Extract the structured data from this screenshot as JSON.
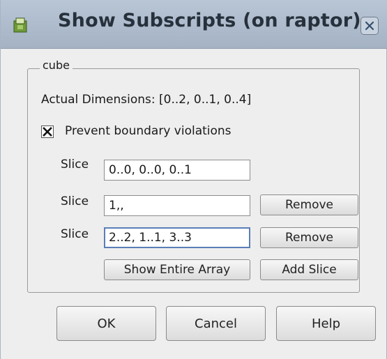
{
  "window": {
    "title": "Show Subscripts (on raptor)"
  },
  "icons": {
    "app": "app-icon",
    "close": "close-icon",
    "checkbox": "check-x-icon"
  },
  "group": {
    "legend": "cube",
    "dimensions_text": "Actual Dimensions: [0..2, 0..1, 0..4]",
    "checkbox": {
      "label": "Prevent boundary violations",
      "checked": true
    },
    "slices": [
      {
        "label": "Slice",
        "value": "0..0, 0..0, 0..1"
      },
      {
        "label": "Slice",
        "value": "1,,",
        "remove_label": "Remove"
      },
      {
        "label": "Slice",
        "value": "2..2, 1..1, 3..3",
        "remove_label": "Remove"
      }
    ],
    "show_entire_label": "Show Entire Array",
    "add_slice_label": "Add Slice"
  },
  "footer": {
    "ok_label": "OK",
    "cancel_label": "Cancel",
    "help_label": "Help"
  },
  "colors": {
    "titlebar": "#b0bdce",
    "focus_border": "#5a7fb8",
    "window_bg": "#eeeeee"
  }
}
